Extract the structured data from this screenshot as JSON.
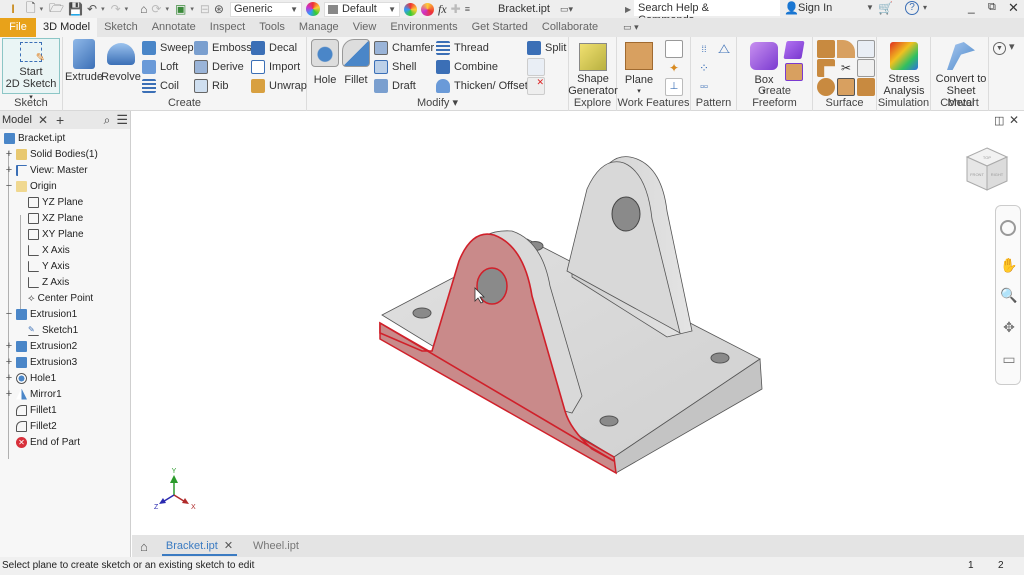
{
  "quick_access": {
    "material_combo": "Generic",
    "appearance_combo": "Default",
    "fx_label": "fx",
    "document_title": "Bracket.ipt",
    "search_placeholder": "Search Help & Commands...",
    "sign_in": "Sign In",
    "help": "?"
  },
  "tabs": [
    {
      "label": "File"
    },
    {
      "label": "3D Model"
    },
    {
      "label": "Sketch"
    },
    {
      "label": "Annotate"
    },
    {
      "label": "Inspect"
    },
    {
      "label": "Tools"
    },
    {
      "label": "Manage"
    },
    {
      "label": "View"
    },
    {
      "label": "Environments"
    },
    {
      "label": "Get Started"
    },
    {
      "label": "Collaborate"
    }
  ],
  "ribbon": {
    "sketch": {
      "title": "Sketch",
      "start_line1": "Start",
      "start_line2": "2D Sketch"
    },
    "create": {
      "title": "Create",
      "extrude": "Extrude",
      "revolve": "Revolve",
      "sweep": "Sweep",
      "loft": "Loft",
      "coil": "Coil",
      "emboss": "Emboss",
      "derive": "Derive",
      "rib": "Rib",
      "decal": "Decal",
      "import": "Import",
      "unwrap": "Unwrap"
    },
    "modify": {
      "title": "Modify ▾",
      "hole": "Hole",
      "fillet": "Fillet",
      "chamfer": "Chamfer",
      "shell": "Shell",
      "draft": "Draft",
      "thread": "Thread",
      "combine": "Combine",
      "thicken": "Thicken/ Offset",
      "split": "Split"
    },
    "explore": {
      "title": "Explore",
      "shape_line1": "Shape",
      "shape_line2": "Generator"
    },
    "work_features": {
      "title": "Work Features",
      "plane": "Plane"
    },
    "pattern": {
      "title": "Pattern"
    },
    "create_freeform": {
      "title": "Create Freeform",
      "box": "Box"
    },
    "surface": {
      "title": "Surface"
    },
    "simulation": {
      "title": "Simulation",
      "stress_line1": "Stress",
      "stress_line2": "Analysis"
    },
    "convert": {
      "title": "Convert",
      "line1": "Convert to",
      "line2": "Sheet Metal"
    }
  },
  "browser": {
    "tab_label": "Model",
    "nodes": [
      {
        "label": "Bracket.ipt"
      },
      {
        "label": "Solid Bodies(1)"
      },
      {
        "label": "View: Master"
      },
      {
        "label": "Origin"
      },
      {
        "label": "YZ Plane"
      },
      {
        "label": "XZ Plane"
      },
      {
        "label": "XY Plane"
      },
      {
        "label": "X Axis"
      },
      {
        "label": "Y Axis"
      },
      {
        "label": "Z Axis"
      },
      {
        "label": "Center Point"
      },
      {
        "label": "Extrusion1"
      },
      {
        "label": "Sketch1"
      },
      {
        "label": "Extrusion2"
      },
      {
        "label": "Extrusion3"
      },
      {
        "label": "Hole1"
      },
      {
        "label": "Mirror1"
      },
      {
        "label": "Fillet1"
      },
      {
        "label": "Fillet2"
      },
      {
        "label": "End of Part"
      }
    ]
  },
  "viewcube": {
    "top": "TOP",
    "front": "FRONT",
    "right": "RIGHT"
  },
  "triad": {
    "x": "X",
    "y": "Y",
    "z": "Z"
  },
  "doc_tabs": [
    {
      "label": "Bracket.ipt",
      "active": true
    },
    {
      "label": "Wheel.ipt",
      "active": false
    }
  ],
  "status": {
    "message": "Select plane to create sketch or an existing sketch to edit",
    "count1": "1",
    "count2": "2"
  },
  "colors": {
    "file_tab": "#e8a21a",
    "highlight_face": "#c98a8a",
    "highlight_edge": "#d0202a",
    "active_doc_tab": "#3b7bc2"
  }
}
